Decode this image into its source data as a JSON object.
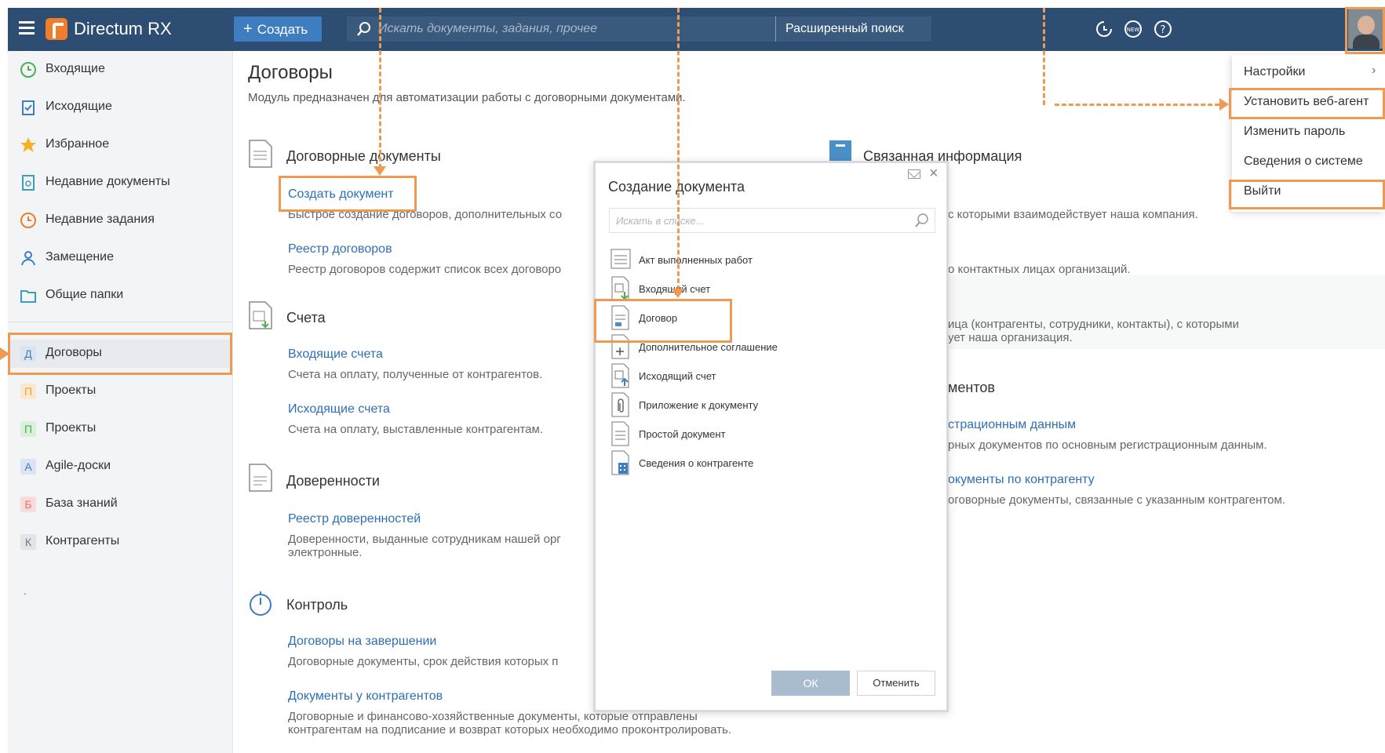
{
  "app": {
    "title": "Directum RX",
    "create_label": "Создать",
    "search_placeholder": "Искать документы, задания, прочее",
    "advanced_search_label": "Расширенный поиск"
  },
  "topbar_icons": [
    "refresh-help-icon",
    "new-badge-icon",
    "help-icon",
    "avatar"
  ],
  "sidebar": {
    "items": [
      {
        "label": "Входящие",
        "icon": "clock-icon"
      },
      {
        "label": "Исходящие",
        "icon": "outbox-icon"
      },
      {
        "label": "Избранное",
        "icon": "star-icon"
      },
      {
        "label": "Недавние документы",
        "icon": "recent-document-icon"
      },
      {
        "label": "Недавние задания",
        "icon": "recent-tasks-icon"
      },
      {
        "label": "Замещение",
        "icon": "user-icon"
      },
      {
        "label": "Общие папки",
        "icon": "folder-icon"
      }
    ],
    "modules": [
      {
        "letter": "Д",
        "label": "Договоры",
        "color": "#4a79b8",
        "bg": "#dbe5f2"
      },
      {
        "letter": "П",
        "label": "Проекты",
        "color": "#e6a23c",
        "bg": "#fbe9cd"
      },
      {
        "letter": "П",
        "label": "Проекты",
        "color": "#4caf50",
        "bg": "#d9efda"
      },
      {
        "letter": "A",
        "label": "Agile-доски",
        "color": "#4a79b8",
        "bg": "#dbe5f2"
      },
      {
        "letter": "Б",
        "label": "База знаний",
        "color": "#e57373",
        "bg": "#f8dcdc"
      },
      {
        "letter": "К",
        "label": "Контрагенты",
        "color": "#6e7a87",
        "bg": "#e2e5e8"
      }
    ],
    "dot": "."
  },
  "main": {
    "title": "Договоры",
    "subtitle": "Модуль предназначен для автоматизации работы с договорными документами.",
    "sections": {
      "contracts": {
        "title": "Договорные документы",
        "links": [
          {
            "label": "Создать документ",
            "desc": "Быстрое создание договоров, дополнительных со"
          },
          {
            "label": "Реестр договоров",
            "desc": "Реестр договоров содержит список всех договоро"
          }
        ]
      },
      "invoices": {
        "title": "Счета",
        "links": [
          {
            "label": "Входящие счета",
            "desc": "Счета на оплату, полученные от контрагентов."
          },
          {
            "label": "Исходящие счета",
            "desc": "Счета на оплату, выставленные контрагентам."
          }
        ]
      },
      "poa": {
        "title": "Доверенности",
        "links": [
          {
            "label": "Реестр доверенностей",
            "desc1": "Доверенности, выданные сотрудникам нашей орг",
            "desc2": "электронные."
          }
        ]
      },
      "control": {
        "title": "Контроль",
        "links": [
          {
            "label": "Договоры на завершении",
            "desc": "Договорные документы, срок действия которых п"
          },
          {
            "label": "Документы у контрагентов",
            "desc1": "Договорные и финансово-хозяйственные документы, которые отправлены",
            "desc2": "контрагентам на подписание и возврат которых необходимо проконтролировать."
          }
        ]
      },
      "related": {
        "title": "Связанная информация",
        "line1": "с которыми взаимодействует наша компания.",
        "line2": "о контактных лицах организаций.",
        "line3": "ица (контрагенты, сотрудники, контакты), с которыми",
        "line4": "ует наша организация.",
        "heading2": "ментов",
        "link1": "страционным данным",
        "desc1": "рных документов по основным регистрационным данным.",
        "link2": "окументы по контрагенту",
        "desc2": "оговорные документы, связанные с указанным контрагентом."
      }
    }
  },
  "dialog": {
    "title": "Создание документа",
    "search_placeholder": "Искать в списке...",
    "items": [
      {
        "label": "Акт выполненных работ",
        "icon": "act-document-icon"
      },
      {
        "label": "Входящий счет",
        "icon": "incoming-invoice-icon"
      },
      {
        "label": "Договор",
        "icon": "contract-document-icon"
      },
      {
        "label": "Дополнительное соглашение",
        "icon": "supplementary-agreement-icon"
      },
      {
        "label": "Исходящий счет",
        "icon": "outgoing-invoice-icon"
      },
      {
        "label": "Приложение к документу",
        "icon": "attachment-document-icon"
      },
      {
        "label": "Простой документ",
        "icon": "simple-document-icon"
      },
      {
        "label": "Сведения о контрагенте",
        "icon": "counterparty-info-icon"
      }
    ],
    "ok_label": "ОК",
    "cancel_label": "Отменить"
  },
  "user_menu": {
    "items": [
      {
        "label": "Настройки",
        "arrow": "›"
      },
      {
        "label": "Установить веб-агент"
      },
      {
        "label": "Изменить пароль"
      },
      {
        "label": "Сведения о системе"
      },
      {
        "label": "Выйти"
      }
    ]
  },
  "colors": {
    "topbar": "#2d4e72",
    "accent": "#3e7ec0",
    "link": "#2e6fb3",
    "highlight": "#ee9a52",
    "logo": "#ef7d2a"
  }
}
